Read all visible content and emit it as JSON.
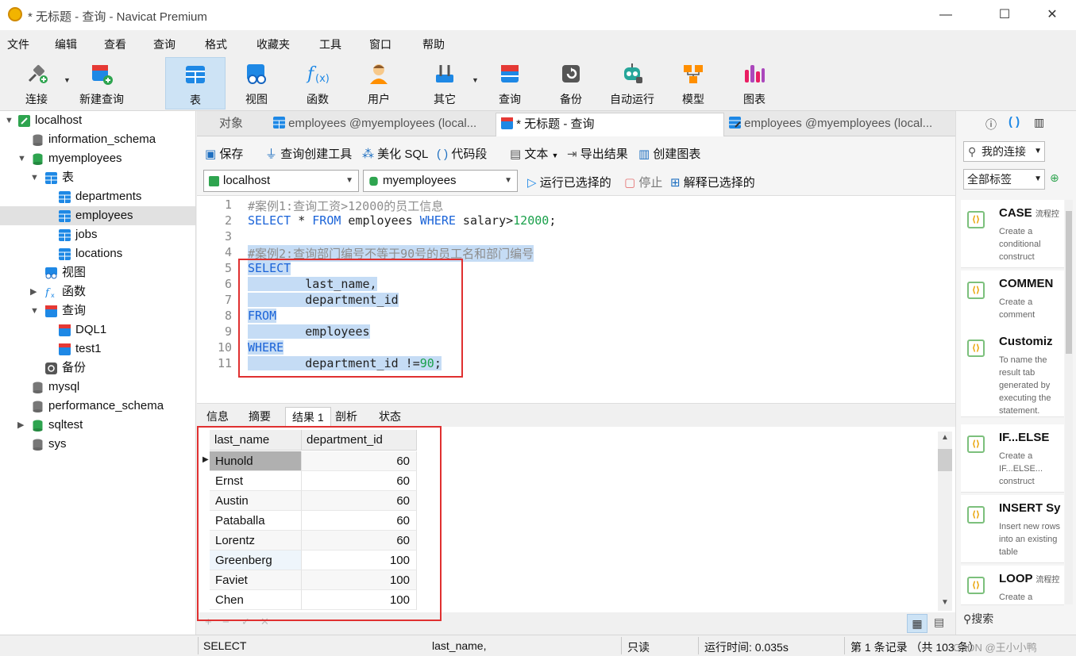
{
  "window": {
    "title": "* 无标题 - 查询 - Navicat Premium",
    "minimize": "—",
    "maximize": "☐",
    "close": "✕"
  },
  "menu": [
    "文件",
    "编辑",
    "查看",
    "查询",
    "格式",
    "收藏夹",
    "工具",
    "窗口",
    "帮助"
  ],
  "toolbar": {
    "connect": "连接",
    "new_query": "新建查询",
    "table": "表",
    "view": "视图",
    "function": "函数",
    "user": "用户",
    "other": "其它",
    "query": "查询",
    "backup": "备份",
    "automation": "自动运行",
    "model": "模型",
    "chart": "图表"
  },
  "tree": {
    "localhost": "localhost",
    "information_schema": "information_schema",
    "myemployees": "myemployees",
    "tables": "表",
    "departments": "departments",
    "employees": "employees",
    "jobs": "jobs",
    "locations": "locations",
    "views": "视图",
    "functions": "函数",
    "queries": "查询",
    "dql1": "DQL1",
    "test1": "test1",
    "backup": "备份",
    "mysql": "mysql",
    "performance_schema": "performance_schema",
    "sqltest": "sqltest",
    "sys": "sys"
  },
  "tabs": {
    "objects": "对象",
    "tab1": "employees @myemployees (local...",
    "tab2": "* 无标题 - 查询",
    "tab3": "employees @myemployees (local..."
  },
  "editor_toolbar": {
    "save": "保存",
    "query_builder": "查询创建工具",
    "beautify": "美化 SQL",
    "snippet": "代码段",
    "text": "文本",
    "export": "导出结果",
    "create_chart": "创建图表",
    "connection": "localhost",
    "database": "myemployees",
    "run_selected": "运行已选择的",
    "stop": "停止",
    "explain_selected": "解释已选择的"
  },
  "code": {
    "l1": "#案例1:查询工资>12000的员工信息",
    "l2a": "SELECT",
    "l2b": " * ",
    "l2c": "FROM",
    "l2d": " employees ",
    "l2e": "WHERE",
    "l2f": " salary>",
    "l2g": "12000",
    "l2h": ";",
    "l4": "#案例2:查询部门编号不等于90号的员工名和部门编号",
    "l5": "SELECT",
    "l6": "        last_name,",
    "l7": "        department_id",
    "l8": "FROM",
    "l9": "        employees",
    "l10": "WHERE",
    "l11a": "        department_id !=",
    "l11b": "90",
    "l11c": ";"
  },
  "result_tabs": [
    "信息",
    "摘要",
    "结果 1",
    "剖析",
    "状态"
  ],
  "grid": {
    "columns": [
      "last_name",
      "department_id"
    ],
    "rows": [
      [
        "Hunold",
        "60"
      ],
      [
        "Ernst",
        "60"
      ],
      [
        "Austin",
        "60"
      ],
      [
        "Pataballa",
        "60"
      ],
      [
        "Lorentz",
        "60"
      ],
      [
        "Greenberg",
        "100"
      ],
      [
        "Faviet",
        "100"
      ],
      [
        "Chen",
        "100"
      ]
    ]
  },
  "right_panel": {
    "my_connections": "我的连接",
    "all_tags": "全部标签",
    "search": "搜索",
    "snippets": [
      {
        "title": "CASE",
        "tag": "流程控",
        "desc": "Create a conditional construct"
      },
      {
        "title": "COMMEN",
        "tag": "",
        "desc": "Create a comment"
      },
      {
        "title": "Customiz",
        "tag": "",
        "desc": "To name the result tab generated by executing the statement."
      },
      {
        "title": "IF...ELSE",
        "tag": "",
        "desc": "Create a IF...ELSE... construct"
      },
      {
        "title": "INSERT Sy",
        "tag": "",
        "desc": "Insert new rows into an existing table"
      },
      {
        "title": "LOOP",
        "tag": "流程控",
        "desc": "Create a"
      }
    ]
  },
  "status": {
    "sql": "SELECT",
    "field": "last_name,",
    "readonly": "只读",
    "runtime": "运行时间: 0.035s",
    "records": "第 1 条记录 （共 103 条）",
    "watermark": "CSDN @王小小鸭"
  },
  "colors": {
    "accent": "#1a63d8",
    "highlight": "#c5dcf5",
    "annotation": "#e03030",
    "comment": "#8d8d8d",
    "number": "#19a04a"
  }
}
